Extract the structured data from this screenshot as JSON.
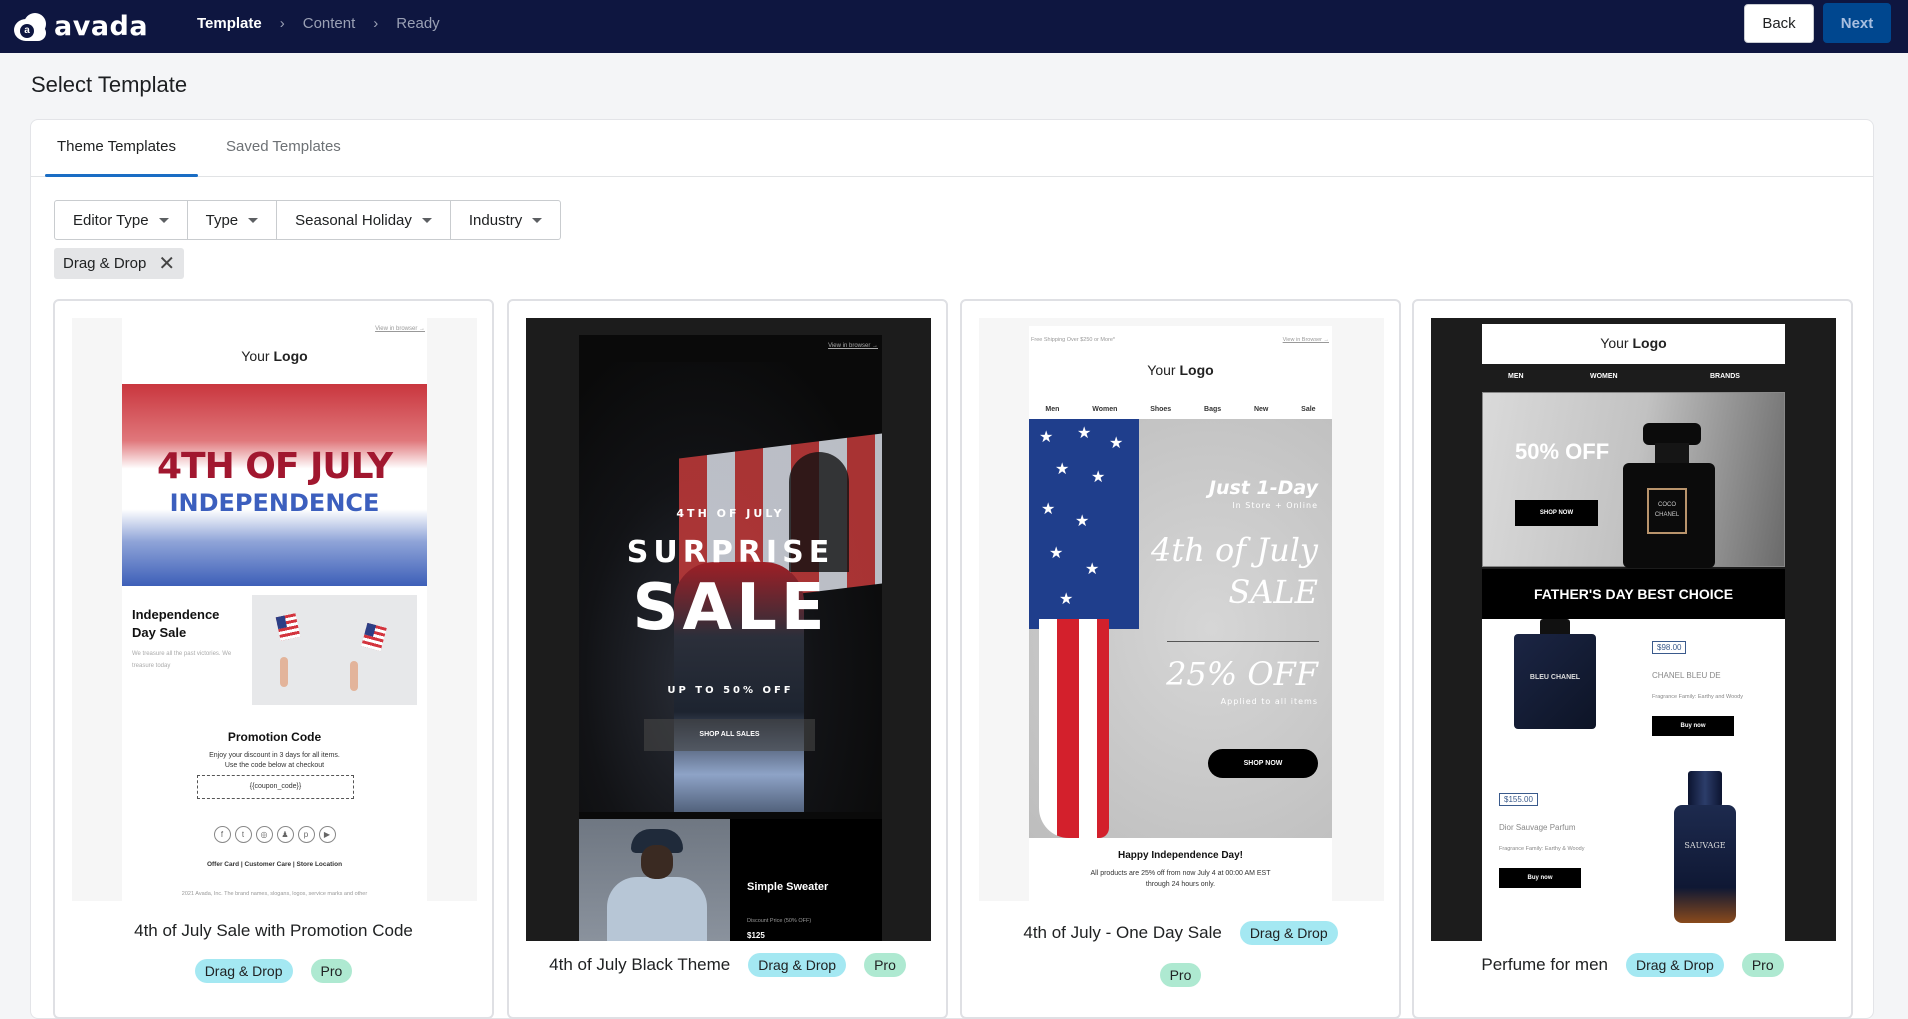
{
  "header": {
    "logo_text": "avada",
    "logo_mark": "a",
    "steps": [
      {
        "label": "Template",
        "active": true
      },
      {
        "label": "Content",
        "active": false
      },
      {
        "label": "Ready",
        "active": false
      }
    ],
    "step_separator": "›",
    "back_label": "Back",
    "next_label": "Next"
  },
  "page": {
    "title": "Select Template"
  },
  "tabs": [
    {
      "label": "Theme Templates",
      "active": true
    },
    {
      "label": "Saved Templates",
      "active": false
    }
  ],
  "filters": [
    {
      "label": "Editor Type"
    },
    {
      "label": "Type"
    },
    {
      "label": "Seasonal Holiday"
    },
    {
      "label": "Industry"
    }
  ],
  "active_filter_chips": [
    {
      "label": "Drag & Drop",
      "remove_icon": "✕"
    }
  ],
  "templates": [
    {
      "name": "4th of July Sale with Promotion Code",
      "badges": [
        "Drag & Drop",
        "Pro"
      ],
      "preview": {
        "view_in_browser": "View in browser →",
        "logo_your": "Your",
        "logo_logo": "Logo",
        "hero_line1": "4TH OF JULY",
        "hero_line2": "INDEPENDENCE",
        "section_title": "Independence Day Sale",
        "section_text": "We treasure all the past victories. We treasure today",
        "promo_title": "Promotion Code",
        "promo_text_1": "Enjoy your discount in 3 days for all items.",
        "promo_text_2": "Use the code below at checkout",
        "coupon": "{{coupon_code}}",
        "social_icons": [
          "facebook-icon",
          "twitter-icon",
          "instagram-icon",
          "snapchat-icon",
          "pinterest-icon",
          "youtube-icon"
        ],
        "footer_links": "Offer Card  |  Customer Care  |  Store Location",
        "copyright": "2021 Avada, Inc. The brand names, slogans, logos, service marks and other"
      }
    },
    {
      "name": "4th of July Black Theme",
      "badges": [
        "Drag & Drop",
        "Pro"
      ],
      "preview": {
        "view_in_browser": "View in browser →",
        "kicker": "4TH OF JULY",
        "headline_1": "SURPRISE",
        "headline_2": "SALE",
        "subline": "UP TO 50% OFF",
        "cta": "SHOP ALL SALES",
        "product_name": "Simple Sweater",
        "discount_label": "Discount Price (50% OFF)",
        "price": "$125"
      }
    },
    {
      "name": "4th of July - One Day Sale",
      "badges": [
        "Drag & Drop",
        "Pro"
      ],
      "preview": {
        "top_note": "Free Shipping Over $250 or More*",
        "view_in_browser": "View in Browser →",
        "logo_your": "Your",
        "logo_logo": "Logo",
        "nav": [
          "Men",
          "Women",
          "Shoes",
          "Bags",
          "New",
          "Sale"
        ],
        "line_1": "Just 1-Day",
        "line_2": "In Store + Online",
        "line_3": "4th of July",
        "line_4": "SALE",
        "line_5": "25% OFF",
        "line_6": "Applied to all items",
        "cta": "SHOP NOW",
        "footer_title": "Happy Independence Day!",
        "footer_text_1": "All products are 25% off from now July 4 at 00:00 AM EST",
        "footer_text_2": "through 24 hours only."
      }
    },
    {
      "name": "Perfume for men",
      "badges": [
        "Drag & Drop",
        "Pro"
      ],
      "preview": {
        "logo_your": "Your",
        "logo_logo": "Logo",
        "nav": [
          "MEN",
          "WOMEN",
          "BRANDS"
        ],
        "hero_offer": "50% OFF",
        "hero_cta": "SHOP NOW",
        "bottle_label": "COCO CHANEL",
        "banner": "FATHER'S DAY BEST CHOICE",
        "products": [
          {
            "price": "$98.00",
            "name": "CHANEL BLEU DE",
            "family": "Fragrance Family: Earthy and Woody",
            "cta": "Buy now",
            "bottle": "BLEU CHANEL"
          },
          {
            "price": "$155.00",
            "name": "Dior Sauvage Parfum",
            "family": "Fragrance Family: Earthy & Woody",
            "cta": "Buy now",
            "bottle": "SAUVAGE"
          }
        ]
      }
    }
  ]
}
